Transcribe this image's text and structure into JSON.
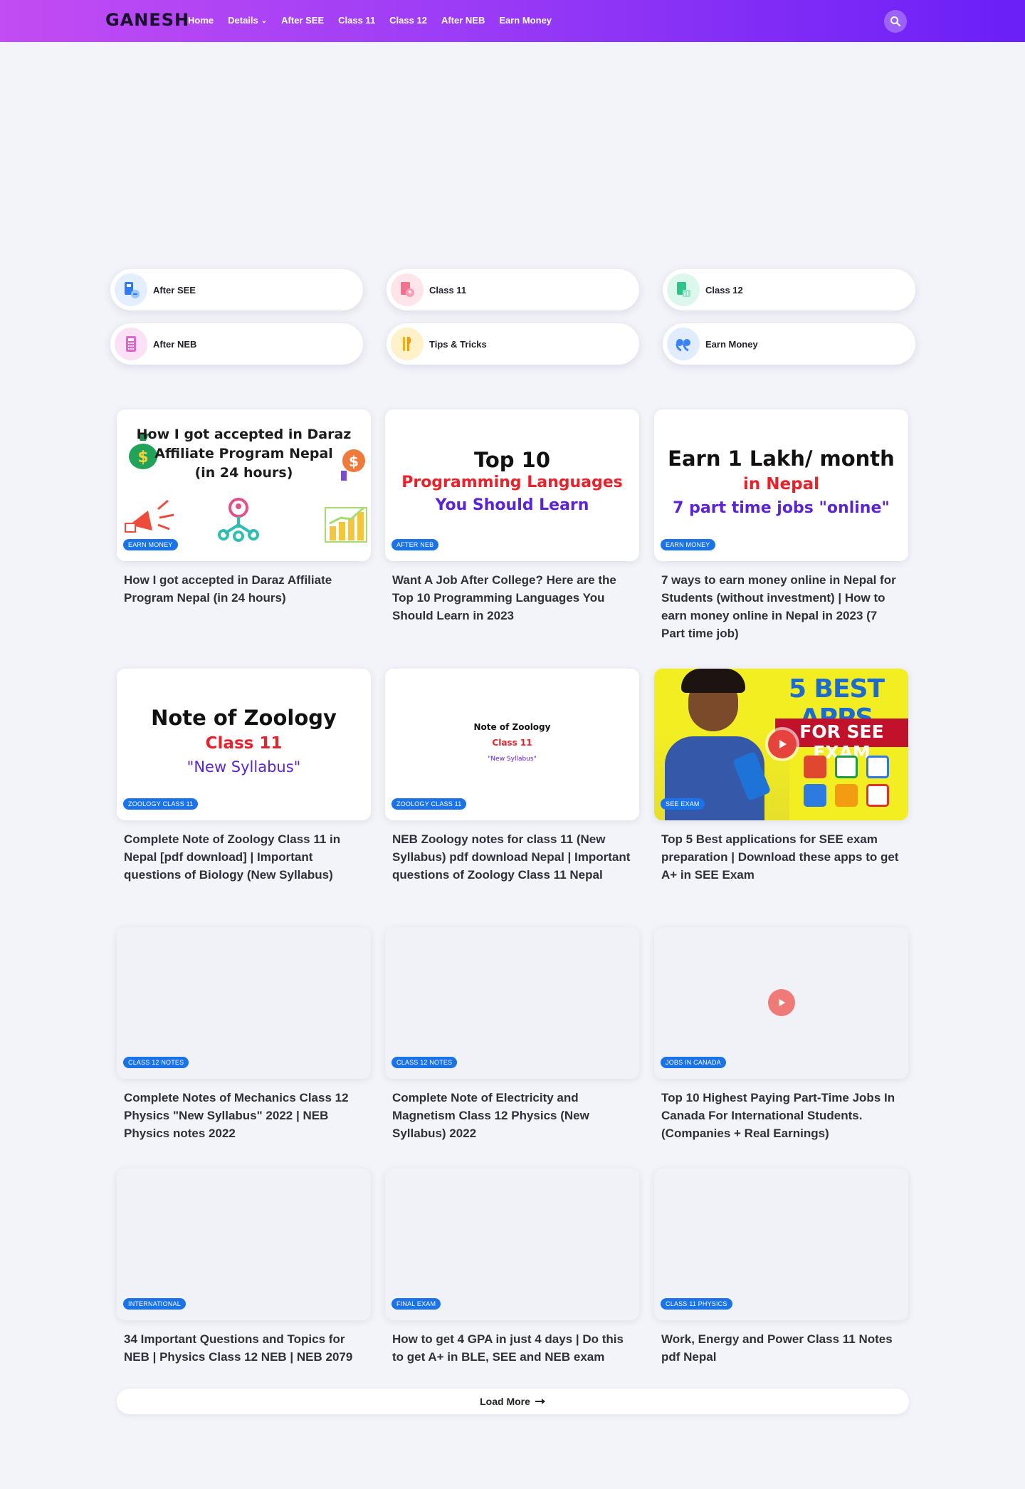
{
  "header": {
    "logo": "GANESH",
    "nav": [
      {
        "label": "Home"
      },
      {
        "label": "Details",
        "dropdown": true
      },
      {
        "label": "After SEE"
      },
      {
        "label": "Class 11"
      },
      {
        "label": "Class 12"
      },
      {
        "label": "After NEB"
      },
      {
        "label": "Earn Money"
      }
    ],
    "search_icon": "search-icon",
    "colors": {
      "gradient_start": "#c34cf3",
      "gradient_end": "#6a1ff7"
    }
  },
  "categories": [
    {
      "label": "After SEE",
      "icon": "phone-book-icon"
    },
    {
      "label": "Class 11",
      "icon": "map-pin-icon"
    },
    {
      "label": "Class 12",
      "icon": "chart-doc-icon"
    },
    {
      "label": "After NEB",
      "icon": "calculator-icon"
    },
    {
      "label": "Tips & Tricks",
      "icon": "fork-knife-icon"
    },
    {
      "label": "Earn Money",
      "icon": "quote-icon"
    }
  ],
  "posts": [
    {
      "badge": "EARN MONEY",
      "title": "How I got accepted in Daraz Affiliate Program Nepal (in 24 hours)",
      "thumb_lines": [
        "How I got accepted in Daraz",
        "Affiliate Program Nepal",
        "(in 24 hours)"
      ]
    },
    {
      "badge": "AFTER NEB",
      "title": "Want A Job After College? Here are the Top 10 Programming Languages You Should Learn in 2023",
      "thumb_lines": [
        "Top 10",
        "Programming Languages",
        "You Should Learn"
      ]
    },
    {
      "badge": "EARN MONEY",
      "title": "7 ways to earn money online in Nepal for Students (without investment) | How to earn money online in Nepal in 2023 (7 Part time job)",
      "thumb_lines": [
        "Earn 1 Lakh/ month",
        "in Nepal",
        "7 part time jobs \"online\""
      ]
    },
    {
      "badge": "ZOOLOGY CLASS 11",
      "title": "Complete Note of Zoology Class 11 in Nepal [pdf download] | Important questions of Biology (New Syllabus)",
      "thumb_lines": [
        "Note of Zoology",
        "Class 11",
        "\"New Syllabus\""
      ]
    },
    {
      "badge": "ZOOLOGY CLASS 11",
      "title": "NEB Zoology notes for class 11 (New Syllabus) pdf download Nepal | Important questions of Zoology Class 11 Nepal",
      "thumb_lines": [
        "Note of Zoology",
        "Class 11",
        "\"New Syllabus\""
      ]
    },
    {
      "badge": "SEE EXAM",
      "title": "Top 5 Best applications for SEE exam preparation | Download these apps to get A+ in SEE Exam",
      "thumb_lines": [
        "5 BEST APPS",
        "FOR SEE EXAM"
      ]
    },
    {
      "badge": "CLASS 12 NOTES",
      "title": "Complete Notes of Mechanics Class 12 Physics \"New Syllabus\" 2022 | NEB Physics notes 2022"
    },
    {
      "badge": "CLASS 12 NOTES",
      "title": "Complete Note of Electricity and Magnetism Class 12 Physics (New Syllabus) 2022"
    },
    {
      "badge": "JOBS IN CANADA",
      "title": "Top 10 Highest Paying Part-Time Jobs In Canada For International Students. (Companies + Real Earnings)"
    },
    {
      "badge": "INTERNATIONAL",
      "title": "34 Important Questions and Topics for NEB | Physics Class 12 NEB | NEB 2079"
    },
    {
      "badge": "FINAL EXAM",
      "title": "How to get 4 GPA in just 4 days | Do this to get A+ in BLE, SEE and NEB exam"
    },
    {
      "badge": "CLASS 11 PHYSICS",
      "title": "Work, Energy and Power Class 11 Notes pdf Nepal"
    }
  ],
  "load_more": {
    "label": "Load More",
    "icon": "arrow-right-icon"
  }
}
